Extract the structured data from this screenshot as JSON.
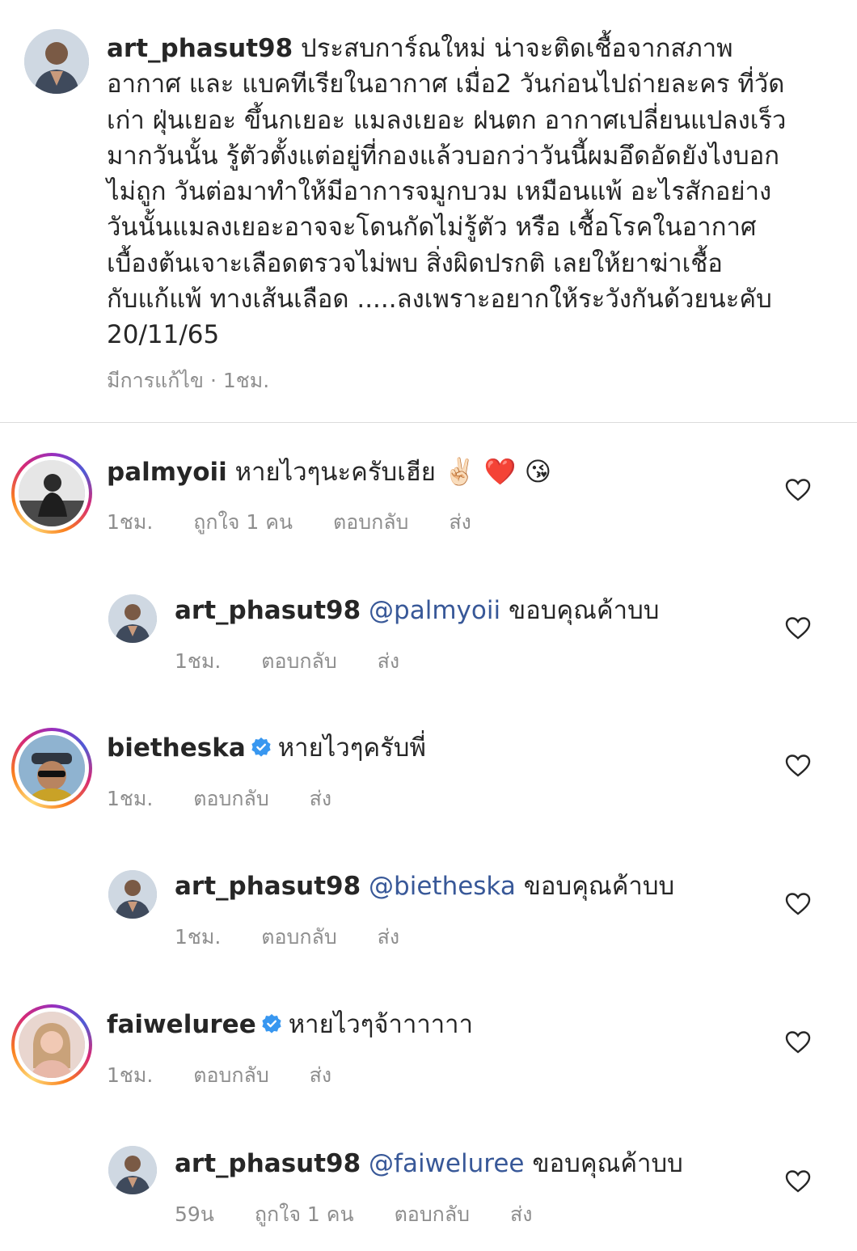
{
  "caption": {
    "username": "art_phasut98",
    "text": "ประสบการ์ณใหม่ น่าจะติดเชื้อจากสภาพ\nอากาศ และ แบคทีเรียในอากาศ เมื่อ2 วันก่อนไปถ่ายละคร ที่วัด\nเก่า ฝุ่นเยอะ ขึ้นกเยอะ แมลงเยอะ ฝนตก อากาศเปลี่ยนแปลงเร็ว\nมากวันนั้น รู้ตัวตั้งแต่อยู่ที่กองแล้วบอกว่าวันนี้ผมอึดอัดยังไงบอก\nไม่ถูก วันต่อมาทำให้มีอาการจมูกบวม เหมือนแพ้ อะไรสักอย่าง\nวันนั้นแมลงเยอะอาจจะโดนกัดไม่รู้ตัว หรือ เชื้อโรคในอากาศ\nเบื้องต้นเจาะเลือดตรวจไม่พบ สิ่งผิดปรกติ เลยให้ยาฆ่าเชื้อ\nกับแก้แพ้ ทางเส้นเลือด .....ลงเพราะอยากให้ระวังกันด้วยนะคับ\n20/11/65",
    "edited": "มีการแก้ไข",
    "time": "1ชม."
  },
  "comments": [
    {
      "username": "palmyoii",
      "verified": false,
      "mention": "",
      "text": "หายไวๆนะครับเฮีย",
      "emojis": "✌🏻 ❤️ 😘",
      "time": "1ชม.",
      "likes": "ถูกใจ 1 คน",
      "reply": "ตอบกลับ",
      "send": "ส่ง",
      "is_reply": false
    },
    {
      "username": "art_phasut98",
      "verified": false,
      "mention": "@palmyoii",
      "text": "ขอบคุณค้าบบ",
      "time": "1ชม.",
      "likes": "",
      "reply": "ตอบกลับ",
      "send": "ส่ง",
      "is_reply": true
    },
    {
      "username": "bietheska",
      "verified": true,
      "mention": "",
      "text": "หายไวๆครับพี่",
      "time": "1ชม.",
      "likes": "",
      "reply": "ตอบกลับ",
      "send": "ส่ง",
      "is_reply": false
    },
    {
      "username": "art_phasut98",
      "verified": false,
      "mention": "@bietheska",
      "text": "ขอบคุณค้าบบ",
      "time": "1ชม.",
      "likes": "",
      "reply": "ตอบกลับ",
      "send": "ส่ง",
      "is_reply": true
    },
    {
      "username": "faiweluree",
      "verified": true,
      "mention": "",
      "text": "หายไวๆจ้าาาาาา",
      "time": "1ชม.",
      "likes": "",
      "reply": "ตอบกลับ",
      "send": "ส่ง",
      "is_reply": false
    },
    {
      "username": "art_phasut98",
      "verified": false,
      "mention": "@faiweluree",
      "text": "ขอบคุณค้าบบ",
      "time": "59น",
      "likes": "ถูกใจ 1 คน",
      "reply": "ตอบกลับ",
      "send": "ส่ง",
      "is_reply": true
    }
  ],
  "colors": {
    "text": "#262626",
    "muted": "#8e8e8e",
    "mention": "#385898",
    "verified": "#3897f0",
    "divider": "#dbdbdb"
  }
}
